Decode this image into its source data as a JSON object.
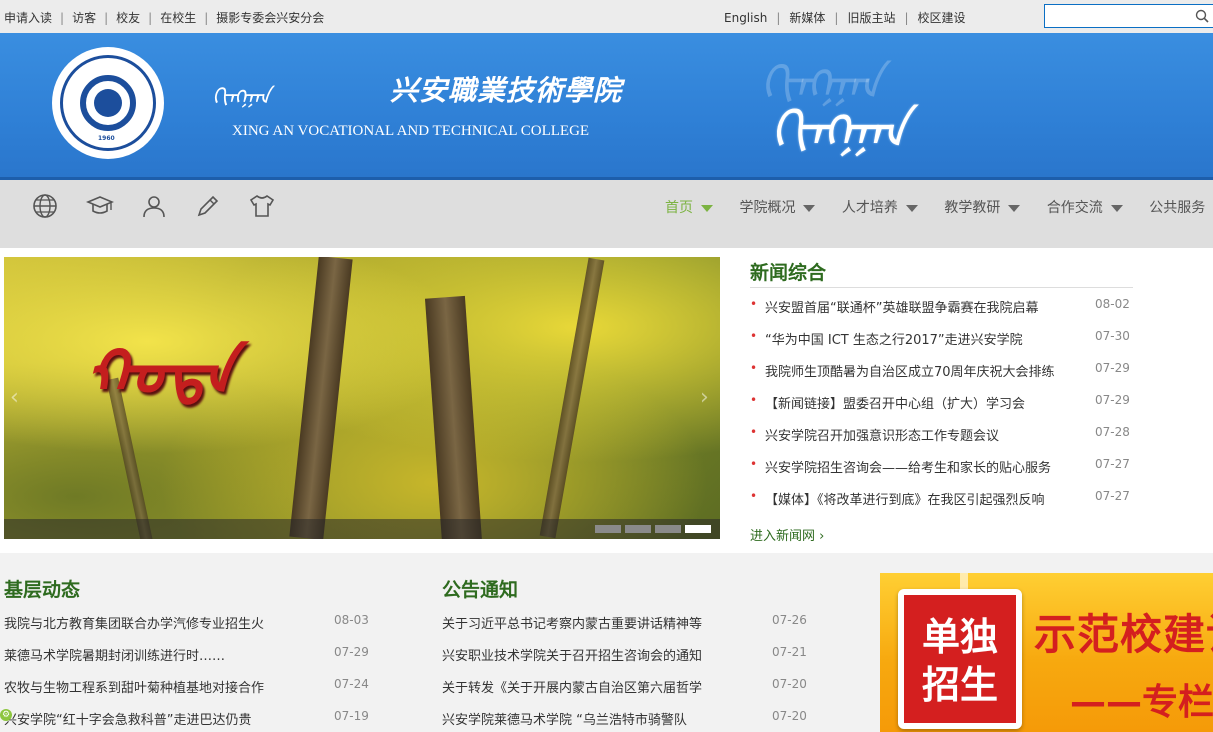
{
  "topbar": {
    "left_links": [
      "申请入读",
      "访客",
      "校友",
      "在校生",
      "摄影专委会兴安分会"
    ],
    "right_links": [
      "English",
      "新媒体",
      "旧版主站",
      "校区建设"
    ],
    "search_placeholder": ""
  },
  "banner": {
    "mongolian_script": "ᠬᠢᠩᠭᠠᠨ",
    "chinese_name": "兴安職業技術學院",
    "english_name": "XING AN VOCATIONAL AND TECHNICAL COLLEGE",
    "logo_year": "1960",
    "decorative_script": "ᠬᠢᠩᠭᠠᠨ"
  },
  "nav": {
    "icons": [
      "globe-icon",
      "graduation-cap-icon",
      "user-icon",
      "pencil-icon",
      "shirt-icon"
    ],
    "menu": [
      {
        "label": "首页",
        "active": true
      },
      {
        "label": "学院概况",
        "active": false
      },
      {
        "label": "人才培养",
        "active": false
      },
      {
        "label": "教学教研",
        "active": false
      },
      {
        "label": "合作交流",
        "active": false
      },
      {
        "label": "公共服务",
        "active": false
      }
    ]
  },
  "slider": {
    "caption": "ᠬᠣᠳᠠ",
    "active_dot": 4,
    "dot_count": 4
  },
  "news": {
    "title": "新闻综合",
    "items": [
      {
        "text": "兴安盟首届“联通杯”英雄联盟争霸赛在我院启幕",
        "date": "08-02"
      },
      {
        "text": "“华为中国 ICT 生态之行2017”走进兴安学院",
        "date": "07-30"
      },
      {
        "text": "我院师生顶酷暑为自治区成立70周年庆祝大会排练",
        "date": "07-29"
      },
      {
        "text": "【新闻链接】盟委召开中心组（扩大）学习会",
        "date": "07-29"
      },
      {
        "text": "兴安学院召开加强意识形态工作专题会议",
        "date": "07-28"
      },
      {
        "text": "兴安学院招生咨询会——给考生和家长的贴心服务",
        "date": "07-27"
      },
      {
        "text": "【媒体】《将改革进行到底》在我区引起强烈反响",
        "date": "07-27"
      }
    ],
    "more": "进入新闻网"
  },
  "grassroots": {
    "title": "基层动态",
    "items": [
      {
        "text": "我院与北方教育集团联合办学汽修专业招生火",
        "date": "08-03"
      },
      {
        "text": "莱德马术学院暑期封闭训练进行时……",
        "date": "07-29"
      },
      {
        "text": "农牧与生物工程系到甜叶菊种植基地对接合作",
        "date": "07-24"
      },
      {
        "text": "兴安学院“红十字会急救科普”走进巴达仍贵",
        "date": "07-19"
      }
    ]
  },
  "notices": {
    "title": "公告通知",
    "items": [
      {
        "text": "关于习近平总书记考察内蒙古重要讲话精神等",
        "date": "07-26"
      },
      {
        "text": "兴安职业技术学院关于召开招生咨询会的通知",
        "date": "07-21"
      },
      {
        "text": "关于转发《关于开展内蒙古自治区第六届哲学",
        "date": "07-20"
      },
      {
        "text": "兴安学院莱德马术学院 “乌兰浩特市骑警队",
        "date": "07-20"
      }
    ]
  },
  "ad": {
    "badge": "单独招生",
    "headline": "示范校建设",
    "subline": "——专栏"
  }
}
